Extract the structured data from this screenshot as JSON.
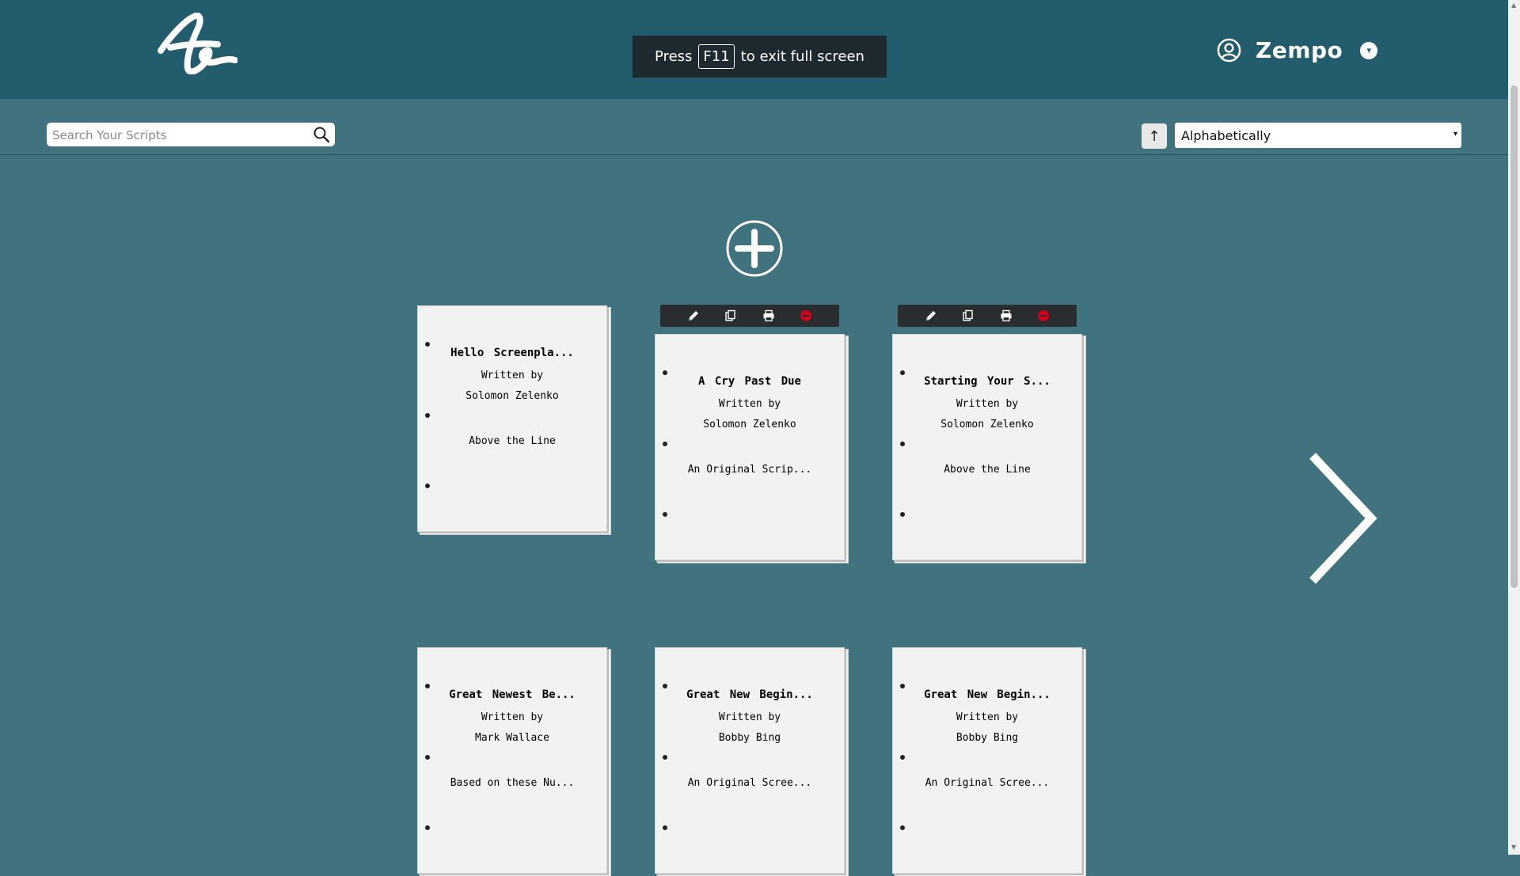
{
  "header": {
    "logo_icon": "autograph-logo-icon",
    "fullscreen_banner": {
      "prefix": "Press",
      "key": "F11",
      "suffix": "to exit full screen"
    },
    "user": {
      "icon": "user-circle-icon",
      "name": "Zempo",
      "menu_caret": "▾"
    }
  },
  "toolbar": {
    "search": {
      "placeholder": "Search Your Scripts",
      "value": ""
    },
    "sort_direction": "↑",
    "sort_by": "Alphabetically",
    "sort_caret": "▾"
  },
  "actions": {
    "add_script_icon": "plus-circle-icon",
    "next_page_icon": "chevron-right-icon"
  },
  "card_tools": [
    "pencil-icon",
    "copy-icon",
    "print-icon",
    "delete-icon"
  ],
  "scripts": [
    {
      "title": "Hello Screenpla...",
      "written_by": "Written by",
      "author": "Solomon Zelenko",
      "note": "Above the Line"
    },
    {
      "title": "A Cry Past Due",
      "written_by": "Written by",
      "author": "Solomon Zelenko",
      "note": "An Original Scrip..."
    },
    {
      "title": "Starting Your S...",
      "written_by": "Written by",
      "author": "Solomon Zelenko",
      "note": "Above the Line"
    },
    {
      "title": "Great Newest Be...",
      "written_by": "Written by",
      "author": "Mark Wallace",
      "note": "Based on these Nu..."
    },
    {
      "title": "Great New Begin...",
      "written_by": "Written by",
      "author": "Bobby Bing",
      "note": "An Original Scree..."
    },
    {
      "title": "Great New Begin...",
      "written_by": "Written by",
      "author": "Bobby Bing",
      "note": "An Original Scree..."
    }
  ],
  "colors": {
    "header_bg": "#235d6d",
    "page_bg": "#41737f",
    "delete_red": "#d0021b"
  }
}
